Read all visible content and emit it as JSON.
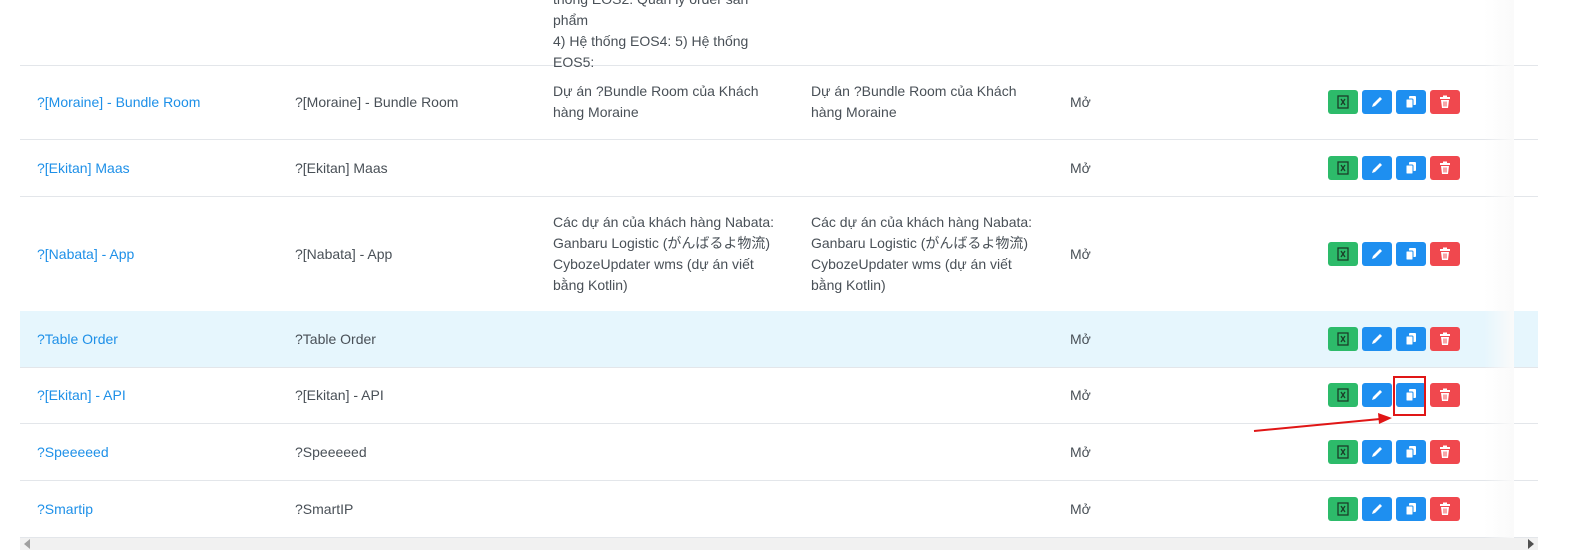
{
  "table": {
    "top_partial_row": {
      "description": "thống EOS2: Quản lý order sản phẩm\n4) Hệ thống EOS4: 5) Hệ thống\nEOS5:"
    },
    "rows": [
      {
        "name": "?[Moraine] - Bundle Room",
        "code": "?[Moraine] - Bundle Room",
        "description_vi": "Dự án ?Bundle Room của Khách\nhàng Moraine",
        "description_2": "Dự án ?Bundle Room của Khách\nhàng Moraine",
        "status": "Mở"
      },
      {
        "name": "?[Ekitan] Maas",
        "code": "?[Ekitan] Maas",
        "description_vi": "",
        "description_2": "",
        "status": "Mở"
      },
      {
        "name": "?[Nabata] - App",
        "code": "?[Nabata] - App",
        "description_vi": "Các dự án của khách hàng Nabata:\nGanbaru Logistic (がんばるよ物流)\nCybozeUpdater wms (dự án viết\nbằng Kotlin)",
        "description_2": "Các dự án của khách hàng Nabata:\nGanbaru Logistic (がんばるよ物流)\nCybozeUpdater wms (dự án viết\nbằng Kotlin)",
        "status": "Mở"
      },
      {
        "name": "?Table Order",
        "code": "?Table Order",
        "description_vi": "",
        "description_2": "",
        "status": "Mở"
      },
      {
        "name": "?[Ekitan] - API",
        "code": "?[Ekitan] - API",
        "description_vi": "",
        "description_2": "",
        "status": "Mở"
      },
      {
        "name": "?Speeeeed",
        "code": "?Speeeeed",
        "description_vi": "",
        "description_2": "",
        "status": "Mở"
      },
      {
        "name": "?Smartip",
        "code": "?SmartIP",
        "description_vi": "",
        "description_2": "",
        "status": "Mở"
      }
    ],
    "action_icons": [
      "excel-icon",
      "pencil-icon",
      "copy-icon",
      "trash-icon"
    ]
  },
  "colors": {
    "link": "#1e90e8",
    "excel_button": "#2dbb6a",
    "edit_button": "#1e8ff0",
    "copy_button": "#1e8ff0",
    "delete_button": "#f0484e",
    "highlight_row": "#e6f6fd",
    "annotation": "#e01616"
  },
  "annotation": {
    "target": "copy-button of row ?[Ekitan] - API"
  }
}
